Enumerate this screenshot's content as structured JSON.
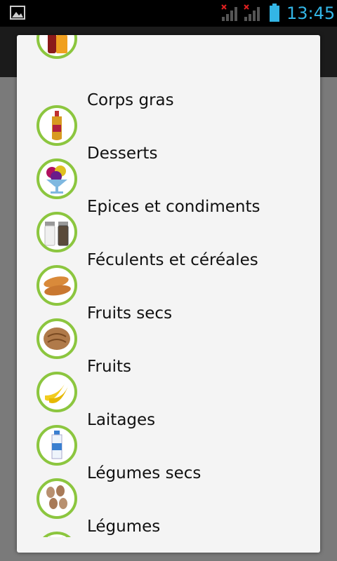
{
  "status_bar": {
    "time": "13:45",
    "accent": "#33b5e5",
    "icons": [
      "gallery-icon",
      "signal-no-data-icon",
      "signal-no-data-icon",
      "battery-icon"
    ]
  },
  "dialog": {
    "items": [
      {
        "label": "",
        "icon": "drinks-icon"
      },
      {
        "label": "Corps gras",
        "icon": "oil-bottle-icon"
      },
      {
        "label": "Desserts",
        "icon": "ice-cream-icon"
      },
      {
        "label": "Epices et condiments",
        "icon": "salt-pepper-icon"
      },
      {
        "label": "Féculents et céréales",
        "icon": "bread-icon"
      },
      {
        "label": "Fruits secs",
        "icon": "walnut-icon"
      },
      {
        "label": "Fruits",
        "icon": "banana-icon"
      },
      {
        "label": "Laitages",
        "icon": "milk-bottle-icon"
      },
      {
        "label": "Légumes secs",
        "icon": "beans-icon"
      },
      {
        "label": "Légumes",
        "icon": "carrot-icon"
      }
    ],
    "thumb_border_color": "#8cc63f"
  }
}
